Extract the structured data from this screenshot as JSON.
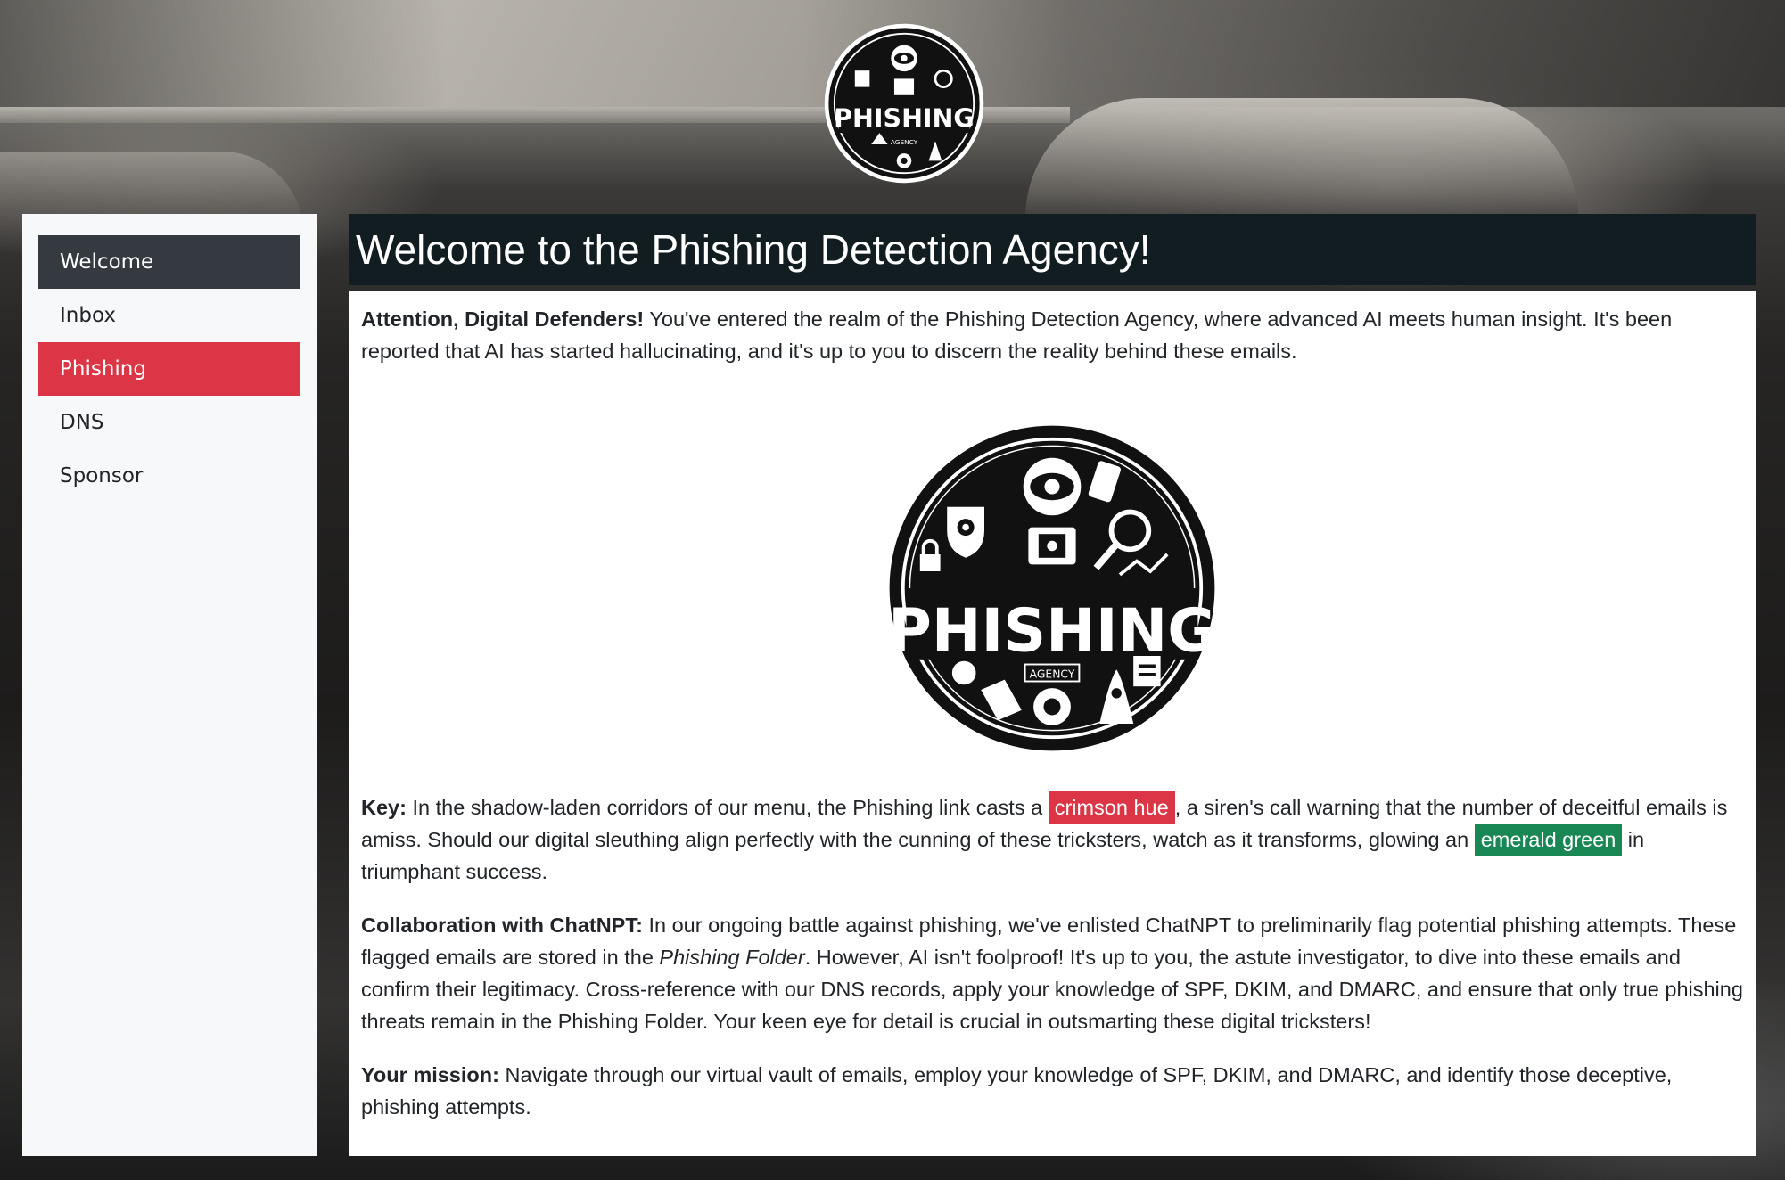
{
  "logo": {
    "text": "PHISHING",
    "subtext": "AGENCY"
  },
  "sidebar": {
    "items": [
      {
        "label": "Welcome"
      },
      {
        "label": "Inbox"
      },
      {
        "label": "Phishing"
      },
      {
        "label": "DNS"
      },
      {
        "label": "Sponsor"
      }
    ]
  },
  "page": {
    "title": "Welcome to the Phishing Detection Agency!"
  },
  "intro": {
    "lead": "Attention, Digital Defenders!",
    "text": " You've entered the realm of the Phishing Detection Agency, where advanced AI meets human insight. It's been reported that AI has started hallucinating, and it's up to you to discern the reality behind these emails."
  },
  "key": {
    "lead": "Key:",
    "text1": " In the shadow-laden corridors of our menu, the Phishing link casts a ",
    "red_label": "crimson hue",
    "text2": ", a siren's call warning that the number of deceitful emails is amiss. Should our digital sleuthing align perfectly with the cunning of these tricksters, watch as it transforms, glowing an ",
    "green_label": "emerald green",
    "text3": " in triumphant success."
  },
  "collab": {
    "lead": "Collaboration with ChatNPT:",
    "text1": " In our ongoing battle against phishing, we've enlisted ChatNPT to preliminarily flag potential phishing attempts. These flagged emails are stored in the ",
    "folder": "Phishing Folder",
    "text2": ". However, AI isn't foolproof! It's up to you, the astute investigator, to dive into these emails and confirm their legitimacy. Cross-reference with our DNS records, apply your knowledge of SPF, DKIM, and DMARC, and ensure that only true phishing threats remain in the Phishing Folder. Your keen eye for detail is crucial in outsmarting these digital tricksters!"
  },
  "mission": {
    "lead": "Your mission:",
    "text": " Navigate through our virtual vault of emails, employ your knowledge of SPF, DKIM, and DMARC, and identify those deceptive, phishing attempts."
  },
  "colors": {
    "active_nav": "#343a40",
    "phishing_nav": "#dc3545",
    "crimson": "#dc3545",
    "emerald": "#198754",
    "title_bar": "#111d20"
  },
  "icons": [
    "phishing-agency-logo-icon"
  ]
}
